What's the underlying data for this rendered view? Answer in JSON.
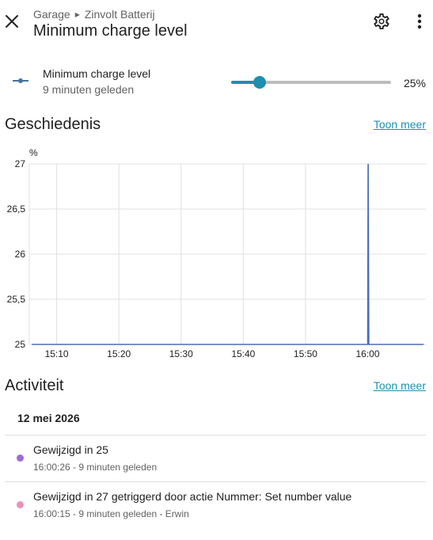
{
  "header": {
    "breadcrumb": [
      "Garage",
      "Zinvolt Batterij"
    ],
    "title": "Minimum charge level"
  },
  "entity": {
    "name": "Minimum charge level",
    "last_changed": "9 minuten geleden",
    "value_label": "25%",
    "slider_fraction": 0.18
  },
  "history": {
    "title": "Geschiedenis",
    "more_label": "Toon meer"
  },
  "chart_data": {
    "type": "line",
    "ylabel": "%",
    "ylim": [
      25,
      27
    ],
    "y_ticks": [
      "25",
      "25,5",
      "26",
      "26,5",
      "27"
    ],
    "x_ticks": [
      "15:10",
      "15:20",
      "15:30",
      "15:40",
      "15:50",
      "16:00"
    ],
    "series": [
      {
        "x": [
          "15:06",
          "16:00",
          "16:00",
          "16:00",
          "16:09"
        ],
        "values": [
          25,
          25,
          27,
          25,
          25
        ]
      }
    ],
    "color": "#4a6fb5",
    "grid": true
  },
  "activity": {
    "title": "Activiteit",
    "more_label": "Toon meer",
    "date": "12 mei 2026",
    "entries": [
      {
        "message": "Gewijzigd in 25",
        "meta": "16:00:26 - 9 minuten geleden",
        "color": "#a06ad6"
      },
      {
        "message": "Gewijzigd in 27 getriggerd door actie Nummer: Set number value",
        "meta": "16:00:15 - 9 minuten geleden - Erwin",
        "color": "#ee8fbd"
      }
    ]
  }
}
